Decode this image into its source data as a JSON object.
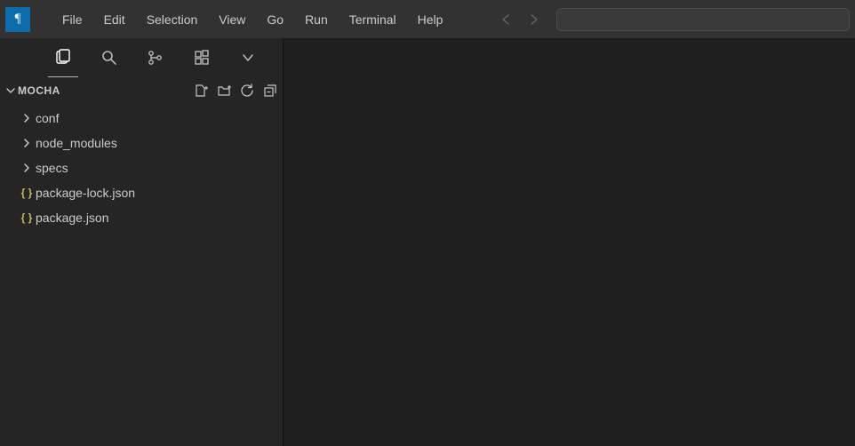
{
  "menu": [
    "File",
    "Edit",
    "Selection",
    "View",
    "Go",
    "Run",
    "Terminal",
    "Help"
  ],
  "project": "MOCHA",
  "tree": [
    {
      "kind": "folder",
      "name": "conf"
    },
    {
      "kind": "folder",
      "name": "node_modules"
    },
    {
      "kind": "folder",
      "name": "specs"
    },
    {
      "kind": "json",
      "name": "package-lock.json"
    },
    {
      "kind": "json",
      "name": "package.json"
    }
  ]
}
